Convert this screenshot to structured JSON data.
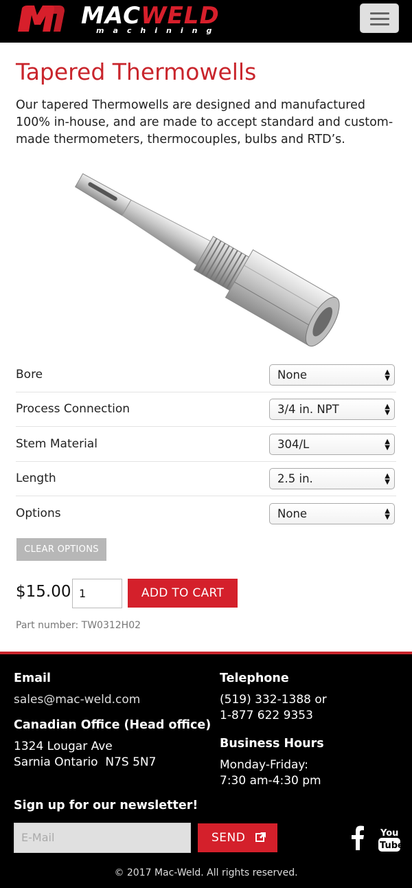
{
  "header": {
    "logo_main_1": "MAC",
    "logo_main_2": "WELD",
    "logo_sub": "machining",
    "menu_icon": "hamburger-icon"
  },
  "product": {
    "title": "Tapered Thermowells",
    "description": "Our tapered Thermowells are designed and manufactured 100% in-house, and are made to accept standard and custom-made thermometers, thermocouples, bulbs and RTD’s.",
    "options": [
      {
        "label": "Bore",
        "value": "None"
      },
      {
        "label": "Process Connection",
        "value": "3/4 in. NPT"
      },
      {
        "label": "Stem Material",
        "value": "304/L"
      },
      {
        "label": "Length",
        "value": "2.5 in."
      },
      {
        "label": "Options",
        "value": "None"
      }
    ],
    "clear_label": "CLEAR OPTIONS",
    "price": "$15.00",
    "quantity": "1",
    "add_to_cart_label": "ADD TO CART",
    "part_number": "Part number: TW0312H02"
  },
  "footer": {
    "email_heading": "Email",
    "email_value": "sales@mac-weld.com",
    "office_heading": "Canadian Office (Head office)",
    "office_line1": "1324 Lougar Ave",
    "office_line2": "Sarnia Ontario  N7S 5N7",
    "phone_heading": "Telephone",
    "phone_line1": "(519) 332-1388 or",
    "phone_line2": "1-877 622 9353",
    "hours_heading": "Business Hours",
    "hours_line1": "Monday-Friday:",
    "hours_line2": "7:30 am-4:30 pm",
    "newsletter_heading": "Sign up for our newsletter!",
    "email_placeholder": "E-Mail",
    "send_label": "SEND",
    "social_icons": [
      "facebook-icon",
      "youtube-icon"
    ],
    "copyright": "© 2017 Mac-Weld. All rights reserved."
  },
  "colors": {
    "brand_red": "#c9252c",
    "button_red": "#d4202b",
    "header_bg": "#000000"
  }
}
